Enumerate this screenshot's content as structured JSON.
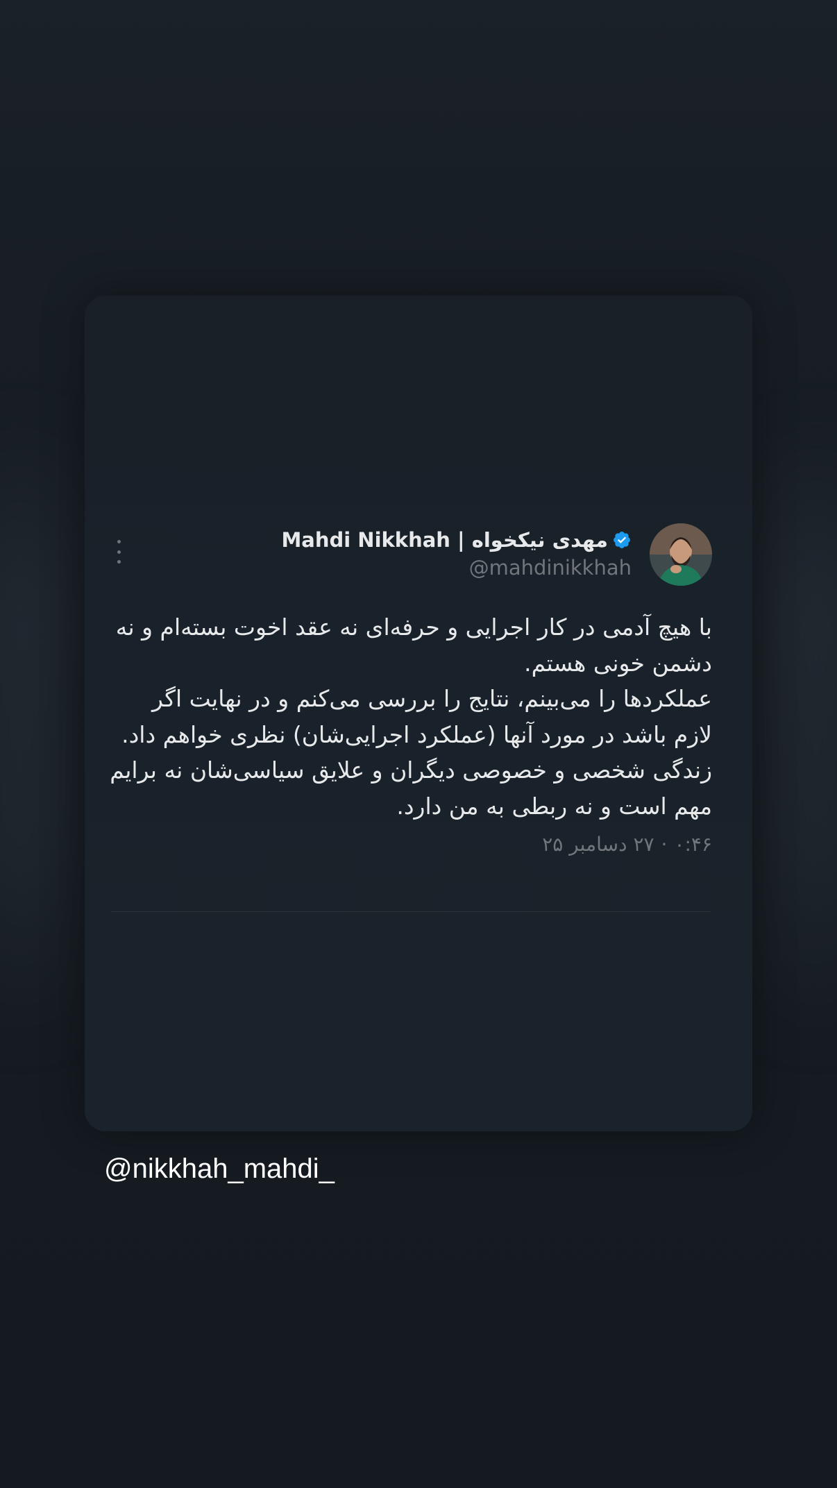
{
  "tweet": {
    "display_name": "مهدی نیکخواه | Mahdi Nikkhah",
    "handle": "@mahdinikkhah",
    "body": "با هیچ آدمی در کار اجرایی و حرفه‌ای نه عقد اخوت بسته‌ام و نه دشمن خونی هستم.\nعملکردها را می‌بینم، نتایج را بررسی می‌کنم و در نهایت اگر لازم باشد در مورد آنها (عملکرد اجرایی‌شان) نظری خواهم داد.\nزندگی شخصی و خصوصی دیگران و علایق سیاسی‌شان نه برایم مهم است و نه ربطی به من دارد.",
    "time": "۰:۴۶",
    "separator": "·",
    "date": "۲۷ دسامبر ۲۵",
    "verified_color": "#1d9bf0",
    "verified_icon": "verified-badge-icon",
    "more_icon": "more-vertical-icon"
  },
  "overlay": {
    "watermark": "@nikkhah_mahdi_"
  }
}
